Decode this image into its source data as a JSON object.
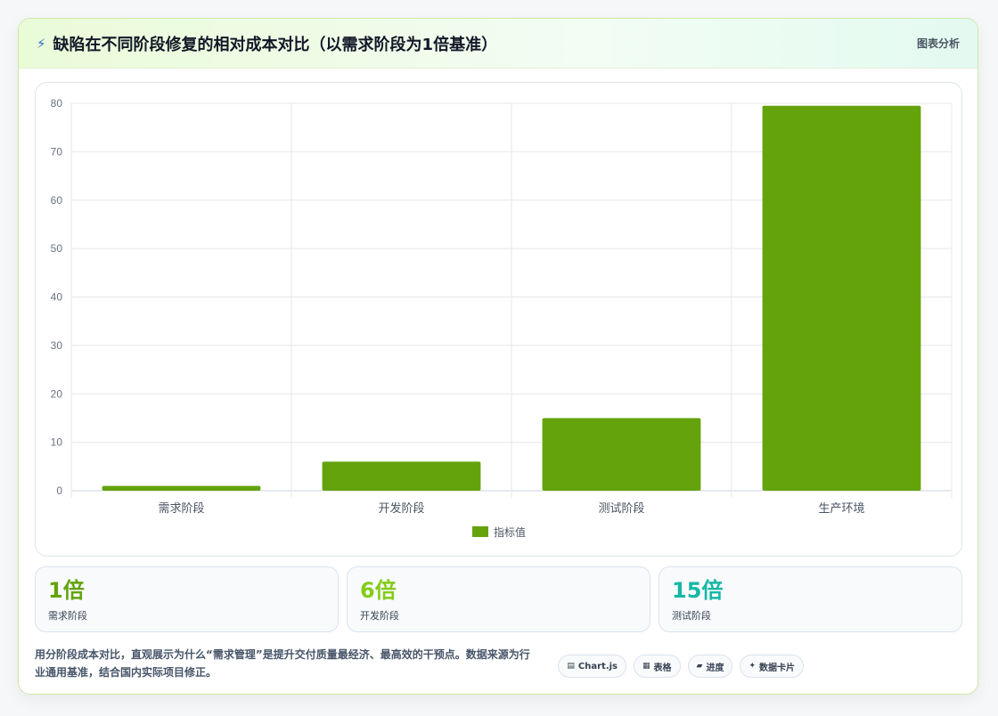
{
  "header": {
    "title": "缺陷在不同阶段修复的相对成本对比（以需求阶段为1倍基准）",
    "tag": "图表分析"
  },
  "chart_data": {
    "type": "bar",
    "categories": [
      "需求阶段",
      "开发阶段",
      "测试阶段",
      "生产环境"
    ],
    "series": [
      {
        "name": "指标值",
        "values": [
          1,
          6,
          15,
          79.5
        ]
      }
    ],
    "ylim": [
      0,
      80
    ],
    "yticks": [
      0,
      10,
      20,
      30,
      40,
      50,
      60,
      70,
      80
    ],
    "grid": true,
    "legend": "bottom",
    "color": "#65a30d"
  },
  "stats": [
    {
      "value": "1倍",
      "label": "需求阶段",
      "color": "#65a30d"
    },
    {
      "value": "6倍",
      "label": "开发阶段",
      "color": "#84cc16"
    },
    {
      "value": "15倍",
      "label": "测试阶段",
      "color": "#14b8a6"
    }
  ],
  "footer": {
    "description": "用分阶段成本对比，直观展示为什么“需求管理”是提升交付质量最经济、最高效的干预点。数据来源为行业通用基准，结合国内实际项目修正。",
    "pills": [
      {
        "icon": "chart-icon",
        "label": "Chart.js"
      },
      {
        "icon": "table-icon",
        "label": "表格"
      },
      {
        "icon": "progress-icon",
        "label": "进度"
      },
      {
        "icon": "sparkle-icon",
        "label": "数据卡片"
      }
    ]
  }
}
